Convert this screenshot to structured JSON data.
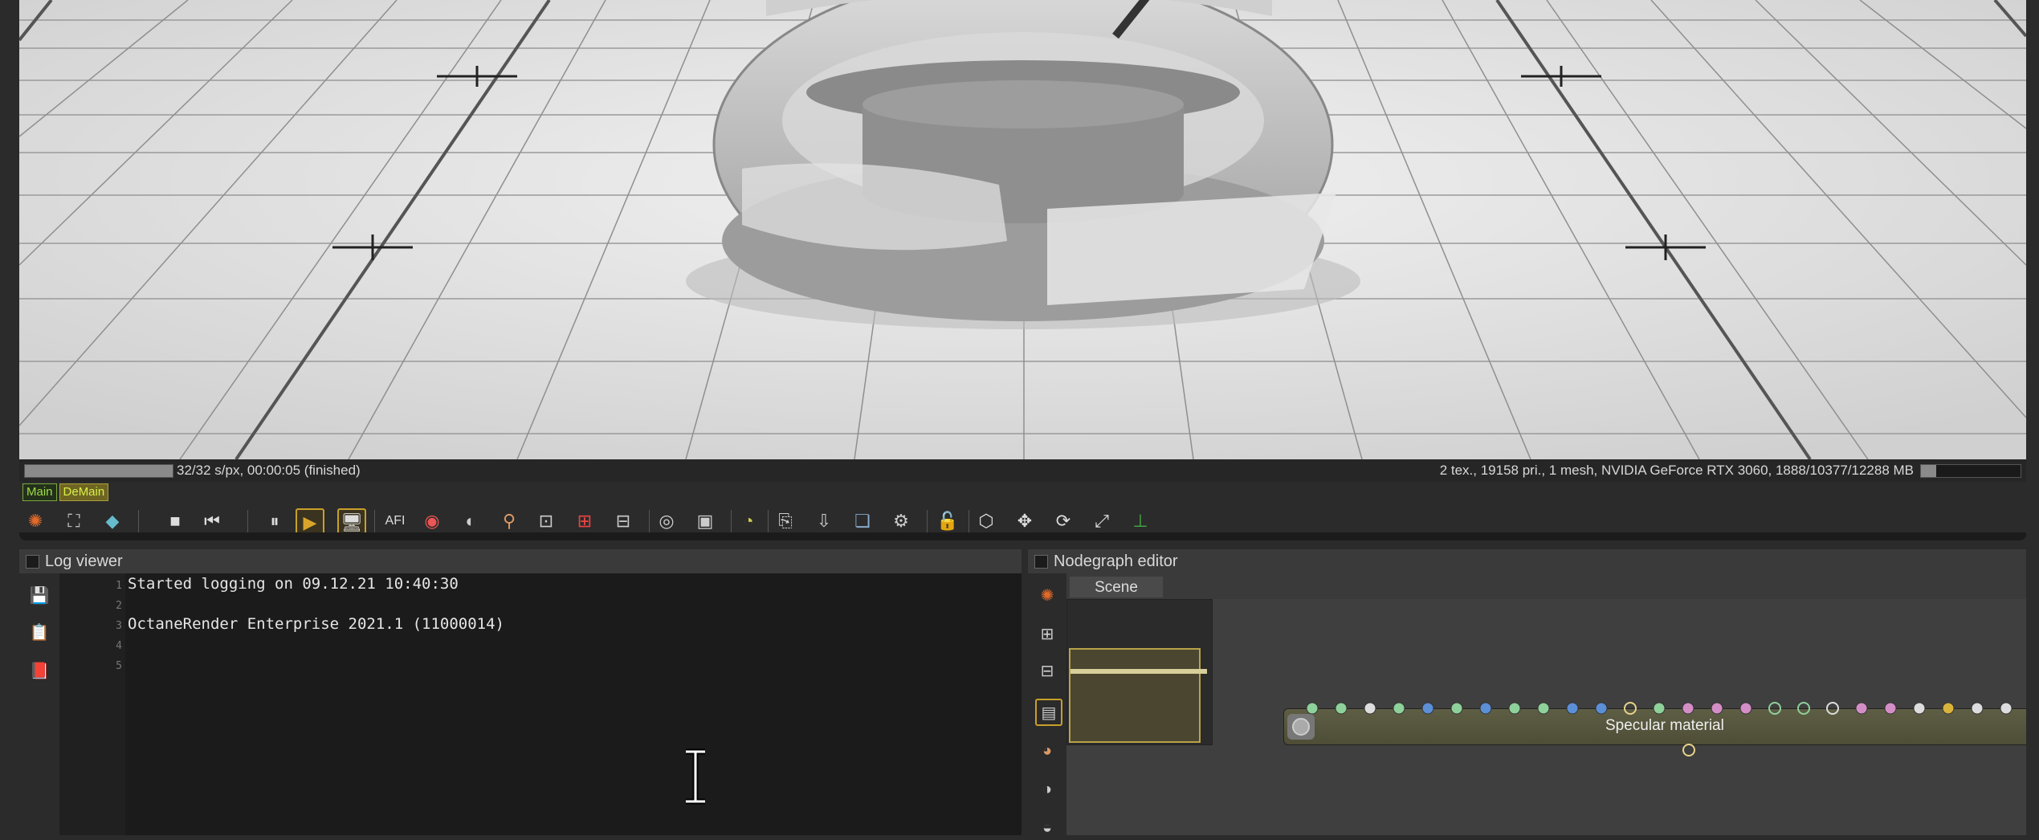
{
  "status": {
    "samples": "32/32 s/px, 00:00:05 (finished)",
    "stats": "2 tex., 19158 pri., 1 mesh, NVIDIA GeForce RTX 3060, 1888/10377/12288 MB",
    "render_progress": 1.0,
    "memory_progress": 0.15
  },
  "tabs": [
    {
      "label": "Main"
    },
    {
      "label": "DeMain"
    }
  ],
  "toolbar": {
    "afi_label": "AFI"
  },
  "log_viewer": {
    "title": "Log viewer",
    "line_numbers": [
      "1",
      "2",
      "3",
      "4",
      "5"
    ],
    "lines": [
      "Started logging on 09.12.21 10:40:30",
      "",
      "OctaneRender Enterprise 2021.1 (11000014)",
      "",
      ""
    ]
  },
  "nodegraph": {
    "title": "Nodegraph editor",
    "tab_label": "Scene",
    "node_label": "Specular material"
  },
  "colors": {
    "accent": "#c8a02a",
    "tab_green": "#9fdc4a"
  }
}
